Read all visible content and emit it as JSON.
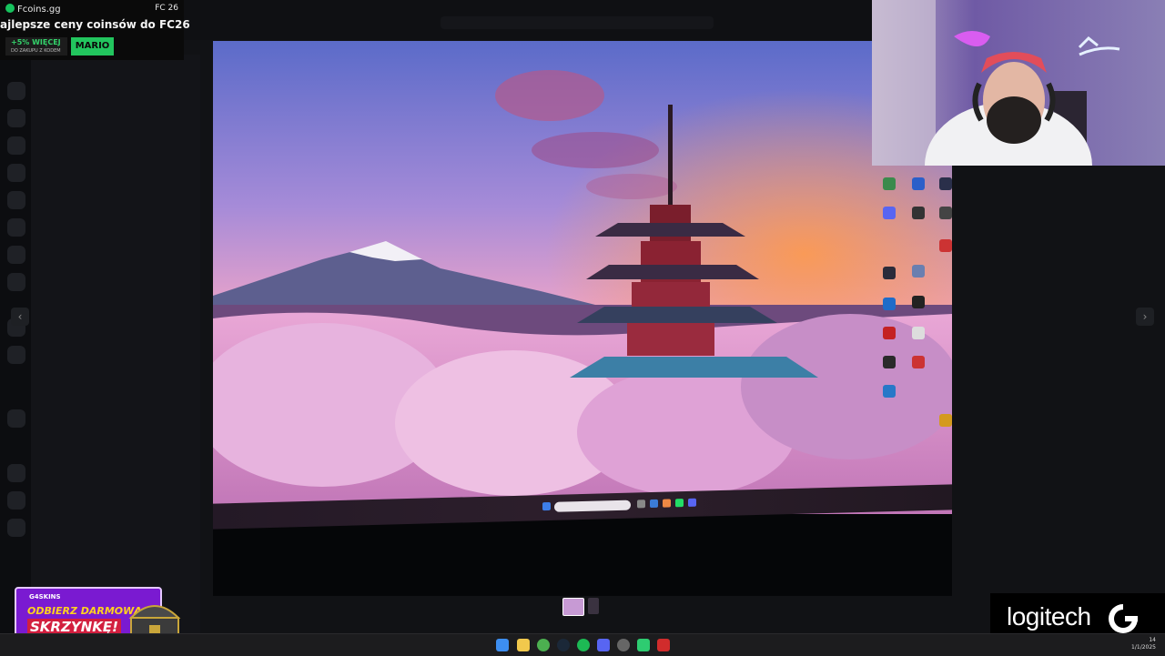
{
  "promo_top": {
    "brand": "Fcoins.gg",
    "game_tag": "FC 26",
    "headline": "ajlepsze ceny coinsów do FC26",
    "bonus_percent": "+5% WIĘCEJ",
    "bonus_subtitle": "DO ZAKUPU Z KODEM",
    "code": "MARIO",
    "accent_color": "#22c55e"
  },
  "skins_ad": {
    "brand": "G4SKINS",
    "line1": "ODBIERZ DARMOWĄ",
    "line2": "SKRZYNKĘ!",
    "bg_color": "#7a1ad1"
  },
  "sponsor": {
    "name": "logitech"
  },
  "wallpaper": {
    "subject": "pagoda-with-mount-fuji-and-cherry-blossoms"
  },
  "taskbar": {
    "icons": [
      "start-icon",
      "file-explorer-icon",
      "chrome-icon",
      "steam-icon",
      "spotify-icon",
      "discord-icon",
      "settings-icon",
      "game-icon",
      "security-icon"
    ],
    "clock_time": "14",
    "clock_date": "1/1/2025"
  }
}
